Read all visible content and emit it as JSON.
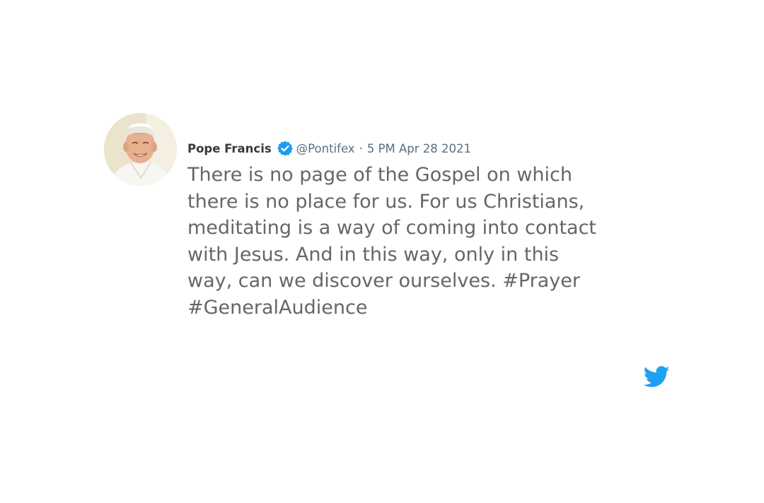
{
  "author": {
    "display_name": "Pope Francis",
    "handle": "@Pontifex",
    "separator": "·",
    "timestamp": "5 PM Apr 28 2021",
    "verified_icon": "verified-badge-icon"
  },
  "tweet": {
    "lines": [
      "There is no page of the Gospel on which",
      "there is no place for us. For us Christians,",
      "meditating is a way of coming into contact",
      "with Jesus. And in this way, only in this",
      "way, can we discover ourselves. #Prayer",
      "#GeneralAudience"
    ]
  },
  "brand": {
    "icon": "twitter-bird-icon",
    "color": "#1da1f2"
  },
  "colors": {
    "text": "#666666",
    "name": "#3a3a3a",
    "meta": "#5b6f80",
    "verified": "#1d9bf0"
  }
}
